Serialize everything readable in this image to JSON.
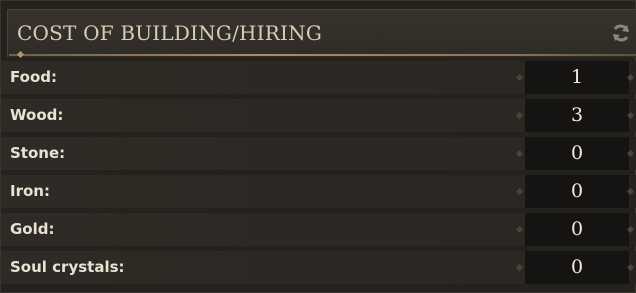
{
  "panel": {
    "title": "COST OF BUILDING/HIRING",
    "refresh_icon": "refresh-icon"
  },
  "costs": [
    {
      "label": "Food:",
      "value": "1"
    },
    {
      "label": "Wood:",
      "value": "3"
    },
    {
      "label": "Stone:",
      "value": "0"
    },
    {
      "label": "Iron:",
      "value": "0"
    },
    {
      "label": "Gold:",
      "value": "0"
    },
    {
      "label": "Soul crystals:",
      "value": "0"
    }
  ],
  "colors": {
    "background": "#24221e",
    "accent_gold": "#a88e62",
    "text": "#e9e2d2"
  }
}
